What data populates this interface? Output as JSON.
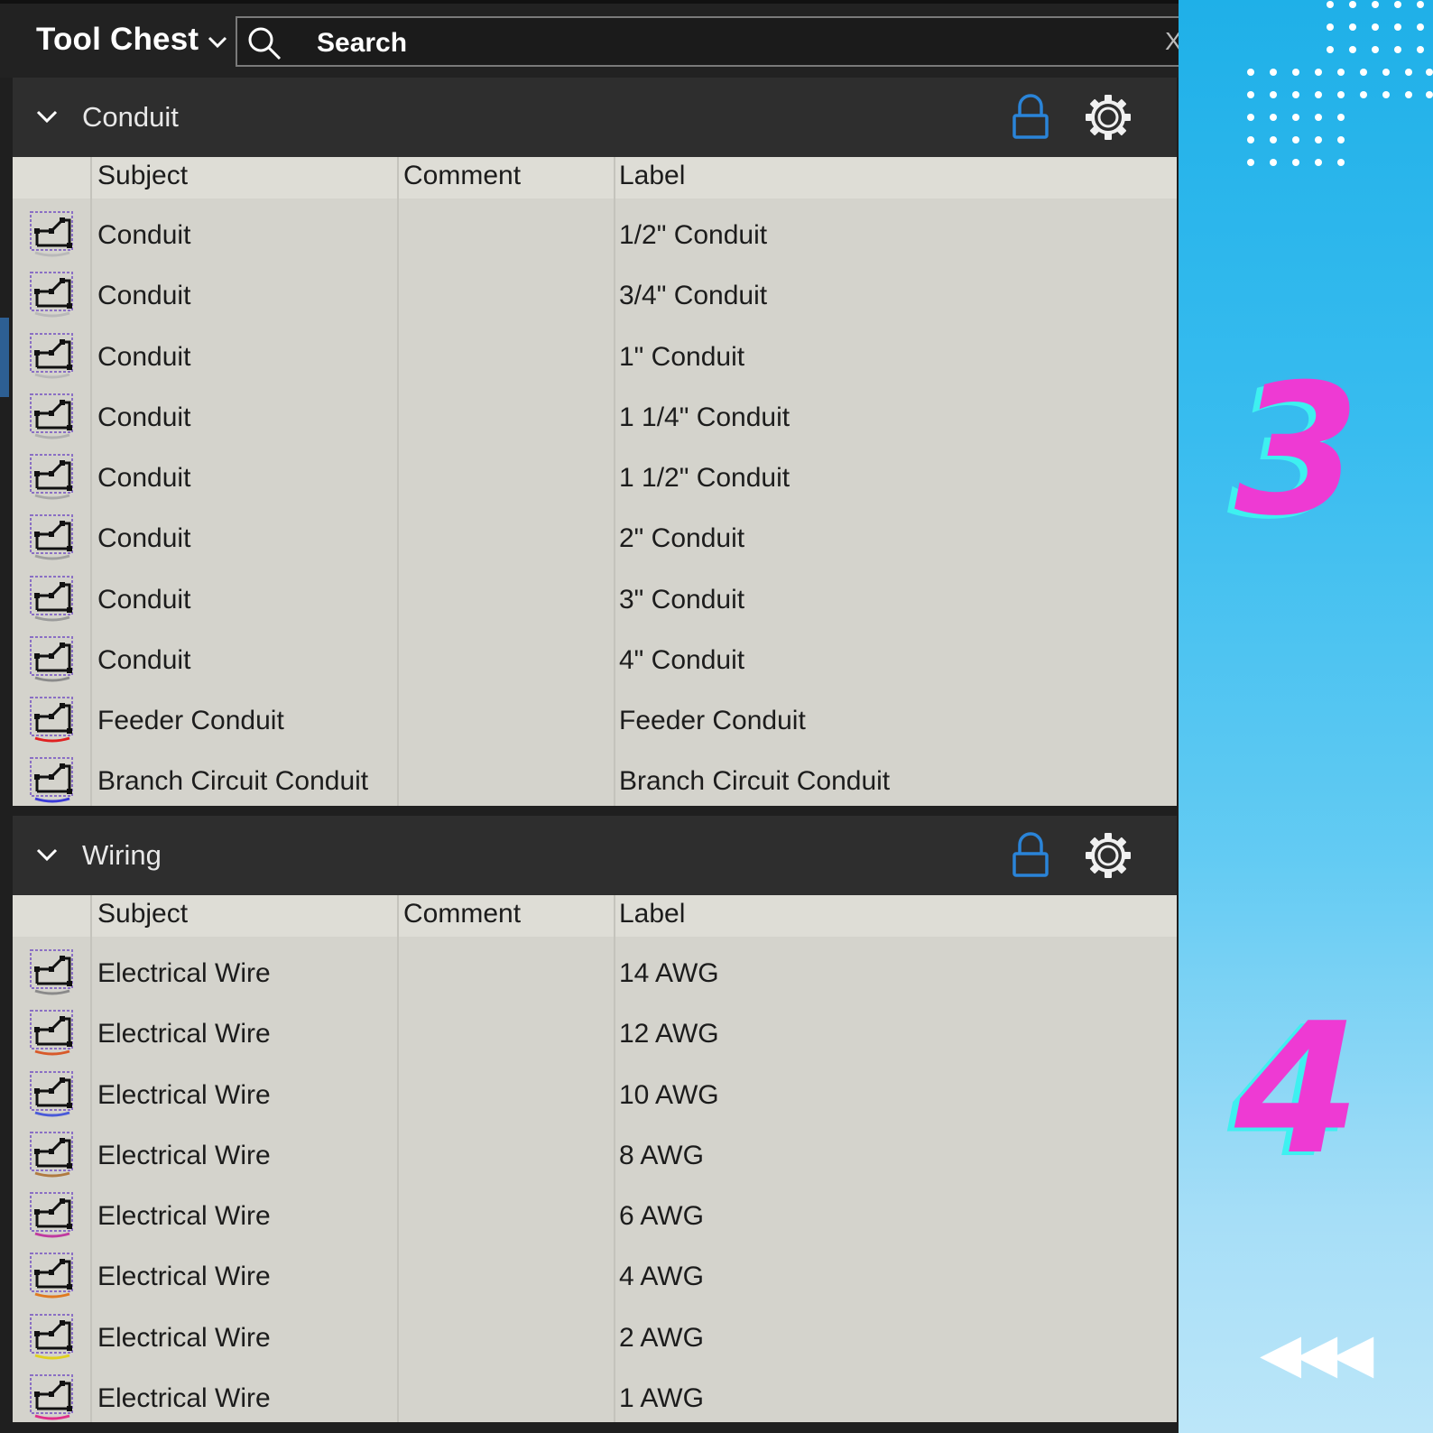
{
  "toolbar": {
    "title": "Tool Chest",
    "search_placeholder": "Search",
    "clear_glyph": "X"
  },
  "sections": [
    {
      "name": "Conduit",
      "columns": [
        "Subject",
        "Comment",
        "Label"
      ],
      "rows": [
        {
          "subject": "Conduit",
          "comment": "",
          "label": "1/2\" Conduit",
          "accent": "#b9b9b9"
        },
        {
          "subject": "Conduit",
          "comment": "",
          "label": "3/4\" Conduit",
          "accent": "#b9b9b9"
        },
        {
          "subject": "Conduit",
          "comment": "",
          "label": "1\" Conduit",
          "accent": "#b9b9b9"
        },
        {
          "subject": "Conduit",
          "comment": "",
          "label": "1 1/4\" Conduit",
          "accent": "#b0b0b0"
        },
        {
          "subject": "Conduit",
          "comment": "",
          "label": "1 1/2\" Conduit",
          "accent": "#a8a8a8"
        },
        {
          "subject": "Conduit",
          "comment": "",
          "label": "2\" Conduit",
          "accent": "#a0a0a0"
        },
        {
          "subject": "Conduit",
          "comment": "",
          "label": "3\" Conduit",
          "accent": "#9a9a9a"
        },
        {
          "subject": "Conduit",
          "comment": "",
          "label": "4\" Conduit",
          "accent": "#8a8a8a"
        },
        {
          "subject": "Feeder Conduit",
          "comment": "",
          "label": "Feeder Conduit",
          "accent": "#e02020"
        },
        {
          "subject": "Branch Circuit Conduit",
          "comment": "",
          "label": "Branch Circuit Conduit",
          "accent": "#3a3ad8"
        }
      ]
    },
    {
      "name": "Wiring",
      "columns": [
        "Subject",
        "Comment",
        "Label"
      ],
      "rows": [
        {
          "subject": "Electrical Wire",
          "comment": "",
          "label": "14 AWG",
          "accent": "#8a8a8a"
        },
        {
          "subject": "Electrical Wire",
          "comment": "",
          "label": "12 AWG",
          "accent": "#d85a2a"
        },
        {
          "subject": "Electrical Wire",
          "comment": "",
          "label": "10 AWG",
          "accent": "#4a5ad8"
        },
        {
          "subject": "Electrical Wire",
          "comment": "",
          "label": "8 AWG",
          "accent": "#b07a40"
        },
        {
          "subject": "Electrical Wire",
          "comment": "",
          "label": "6 AWG",
          "accent": "#c03aa0"
        },
        {
          "subject": "Electrical Wire",
          "comment": "",
          "label": "4 AWG",
          "accent": "#e07a20"
        },
        {
          "subject": "Electrical Wire",
          "comment": "",
          "label": "2 AWG",
          "accent": "#e0d020"
        },
        {
          "subject": "Electrical Wire",
          "comment": "",
          "label": "1 AWG",
          "accent": "#e0308a"
        }
      ]
    }
  ],
  "icons": {
    "row_tool": "polyline-markup-icon",
    "lock": "lock-icon",
    "settings": "gear-icon",
    "collapse": "chevron-down-icon",
    "search": "search-icon"
  },
  "colors": {
    "lock": "#2a84d8",
    "panel": "#d4d3cc",
    "header": "#2e2e2e"
  },
  "decoration": {
    "digits": [
      "3",
      "4"
    ],
    "arrows": "◀◀◀"
  }
}
